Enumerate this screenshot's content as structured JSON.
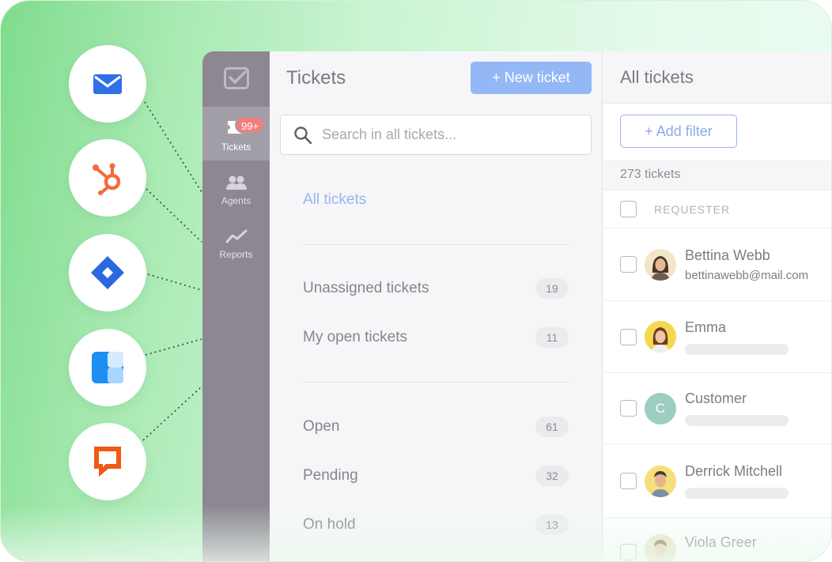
{
  "integrations": [
    {
      "name": "email",
      "color": "#2f6fe8"
    },
    {
      "name": "hubspot",
      "color": "#f26b3a"
    },
    {
      "name": "jira",
      "color": "#2b68e0"
    },
    {
      "name": "blue-app",
      "color": "#1d8ff2"
    },
    {
      "name": "livechat",
      "color": "#f05a14"
    }
  ],
  "nav": {
    "items": [
      {
        "label": "Tickets",
        "badge": "99+",
        "icon": "ticket-icon",
        "active": true
      },
      {
        "label": "Agents",
        "icon": "agents-icon",
        "active": false
      },
      {
        "label": "Reports",
        "icon": "reports-icon",
        "active": false
      }
    ]
  },
  "tickets_panel": {
    "title": "Tickets",
    "new_ticket": "+ New ticket",
    "search_placeholder": "Search in all tickets...",
    "all_tickets_link": "All tickets",
    "groups": [
      [
        {
          "label": "Unassigned tickets",
          "count": "19"
        },
        {
          "label": "My open tickets",
          "count": "11"
        }
      ],
      [
        {
          "label": "Open",
          "count": "61"
        },
        {
          "label": "Pending",
          "count": "32"
        },
        {
          "label": "On hold",
          "count": "13"
        }
      ]
    ]
  },
  "all_tickets": {
    "title": "All tickets",
    "add_filter": "+ Add filter",
    "count_text": "273 tickets",
    "column_requester": "REQUESTER",
    "rows": [
      {
        "name": "Bettina Webb",
        "email": "bettinawebb@mail.com",
        "avatar": "photo"
      },
      {
        "name": "Emma",
        "email": "",
        "avatar": "photo"
      },
      {
        "name": "Customer",
        "email": "",
        "avatar": "initial",
        "initial": "C"
      },
      {
        "name": "Derrick Mitchell",
        "email": "",
        "avatar": "photo"
      },
      {
        "name": "Viola Greer",
        "email": "",
        "avatar": "photo"
      }
    ]
  },
  "colors": {
    "accent": "#94b8f6",
    "link": "#9ab4ef",
    "badge": "#f27d7d",
    "sidebar": "#8d8791"
  }
}
